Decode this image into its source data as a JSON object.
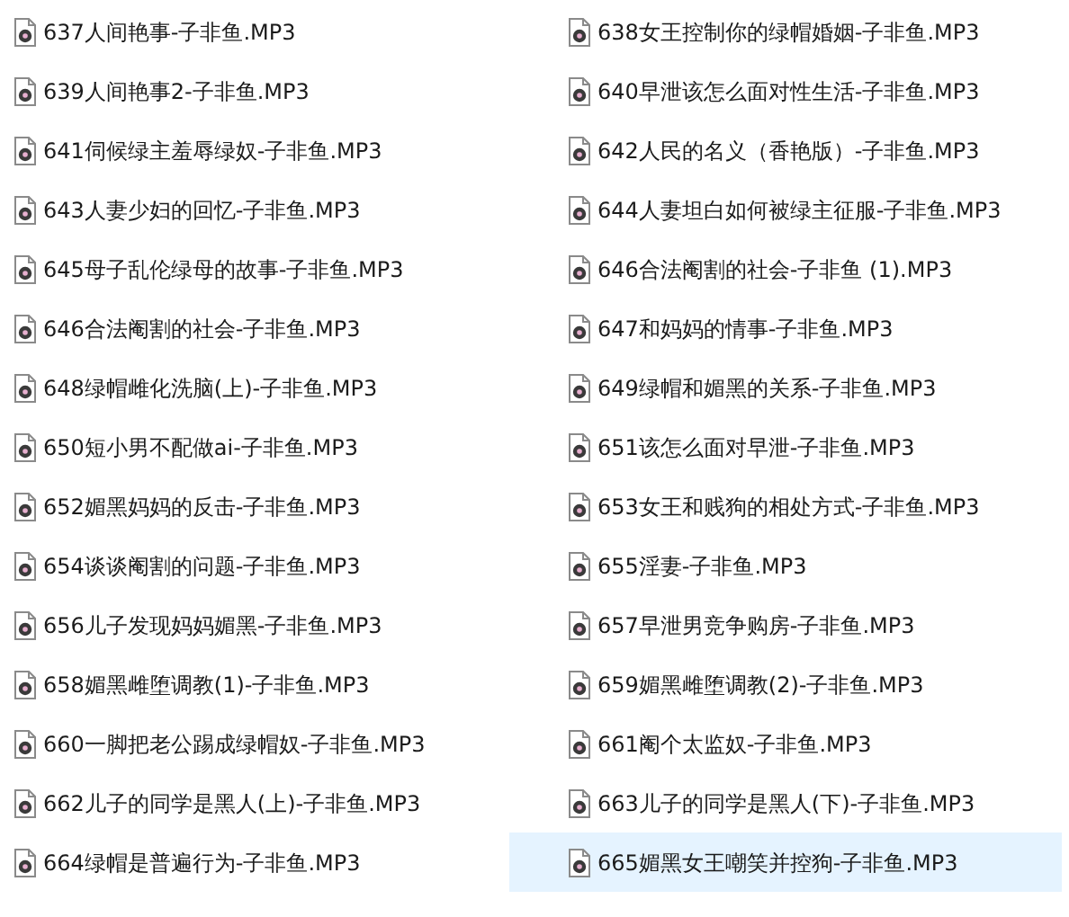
{
  "files": [
    {
      "name": "637人间艳事-子非鱼.MP3",
      "selected": false
    },
    {
      "name": "638女王控制你的绿帽婚姻-子非鱼.MP3",
      "selected": false
    },
    {
      "name": "639人间艳事2-子非鱼.MP3",
      "selected": false
    },
    {
      "name": "640早泄该怎么面对性生活-子非鱼.MP3",
      "selected": false
    },
    {
      "name": "641伺候绿主羞辱绿奴-子非鱼.MP3",
      "selected": false
    },
    {
      "name": "642人民的名义（香艳版）-子非鱼.MP3",
      "selected": false
    },
    {
      "name": "643人妻少妇的回忆-子非鱼.MP3",
      "selected": false
    },
    {
      "name": "644人妻坦白如何被绿主征服-子非鱼.MP3",
      "selected": false
    },
    {
      "name": "645母子乱伦绿母的故事-子非鱼.MP3",
      "selected": false
    },
    {
      "name": "646合法阉割的社会-子非鱼 (1).MP3",
      "selected": false
    },
    {
      "name": "646合法阉割的社会-子非鱼.MP3",
      "selected": false
    },
    {
      "name": "647和妈妈的情事-子非鱼.MP3",
      "selected": false
    },
    {
      "name": "648绿帽雌化洗脑(上)-子非鱼.MP3",
      "selected": false
    },
    {
      "name": "649绿帽和媚黑的关系-子非鱼.MP3",
      "selected": false
    },
    {
      "name": "650短小男不配做ai-子非鱼.MP3",
      "selected": false
    },
    {
      "name": "651该怎么面对早泄-子非鱼.MP3",
      "selected": false
    },
    {
      "name": "652媚黑妈妈的反击-子非鱼.MP3",
      "selected": false
    },
    {
      "name": "653女王和贱狗的相处方式-子非鱼.MP3",
      "selected": false
    },
    {
      "name": "654谈谈阉割的问题-子非鱼.MP3",
      "selected": false
    },
    {
      "name": "655淫妻-子非鱼.MP3",
      "selected": false
    },
    {
      "name": "656儿子发现妈妈媚黑-子非鱼.MP3",
      "selected": false
    },
    {
      "name": "657早泄男竞争购房-子非鱼.MP3",
      "selected": false
    },
    {
      "name": "658媚黑雌堕调教(1)-子非鱼.MP3",
      "selected": false
    },
    {
      "name": "659媚黑雌堕调教(2)-子非鱼.MP3",
      "selected": false
    },
    {
      "name": "660一脚把老公踢成绿帽奴-子非鱼.MP3",
      "selected": false
    },
    {
      "name": "661阉个太监奴-子非鱼.MP3",
      "selected": false
    },
    {
      "name": "662儿子的同学是黑人(上)-子非鱼.MP3",
      "selected": false
    },
    {
      "name": "663儿子的同学是黑人(下)-子非鱼.MP3",
      "selected": false
    },
    {
      "name": "664绿帽是普遍行为-子非鱼.MP3",
      "selected": false
    },
    {
      "name": "665媚黑女王嘲笑并控狗-子非鱼.MP3",
      "selected": true
    }
  ]
}
